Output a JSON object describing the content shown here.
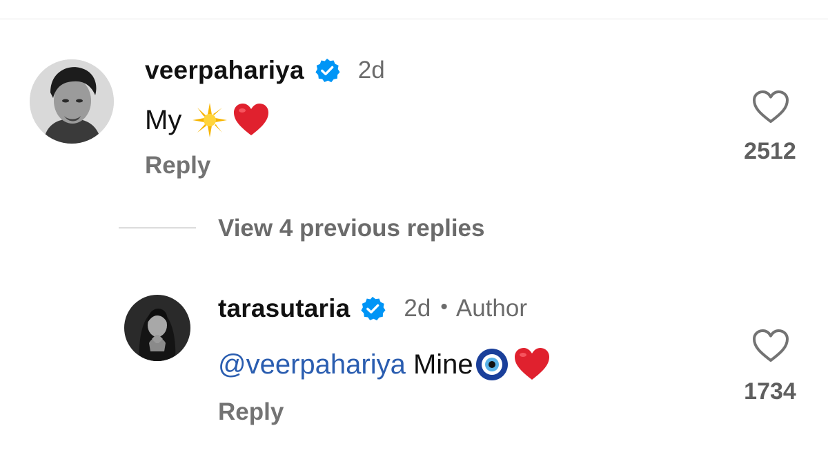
{
  "comments": [
    {
      "username": "veerpahariya",
      "time": "2d",
      "text_prefix": "My",
      "emojis": [
        "sun-sparkle-emoji",
        "red-heart-emoji"
      ],
      "reply_label": "Reply",
      "likes": "2512",
      "verified": true
    },
    {
      "username": "tarasutaria",
      "time": "2d",
      "separator": "•",
      "author_label": "Author",
      "mention": "@veerpahariya",
      "text": " Mine",
      "emojis": [
        "nazar-amulet-emoji",
        "red-heart-emoji"
      ],
      "reply_label": "Reply",
      "likes": "1734",
      "verified": true
    }
  ],
  "thread": {
    "view_replies_label": "View 4 previous replies"
  },
  "colors": {
    "verified_blue": "#0095f6",
    "mention_blue": "#2a5db0",
    "heart_red": "#e0212e",
    "muted_text": "#737373"
  },
  "icons": {
    "like": "heart-outline-icon",
    "verified": "verified-badge-icon"
  }
}
